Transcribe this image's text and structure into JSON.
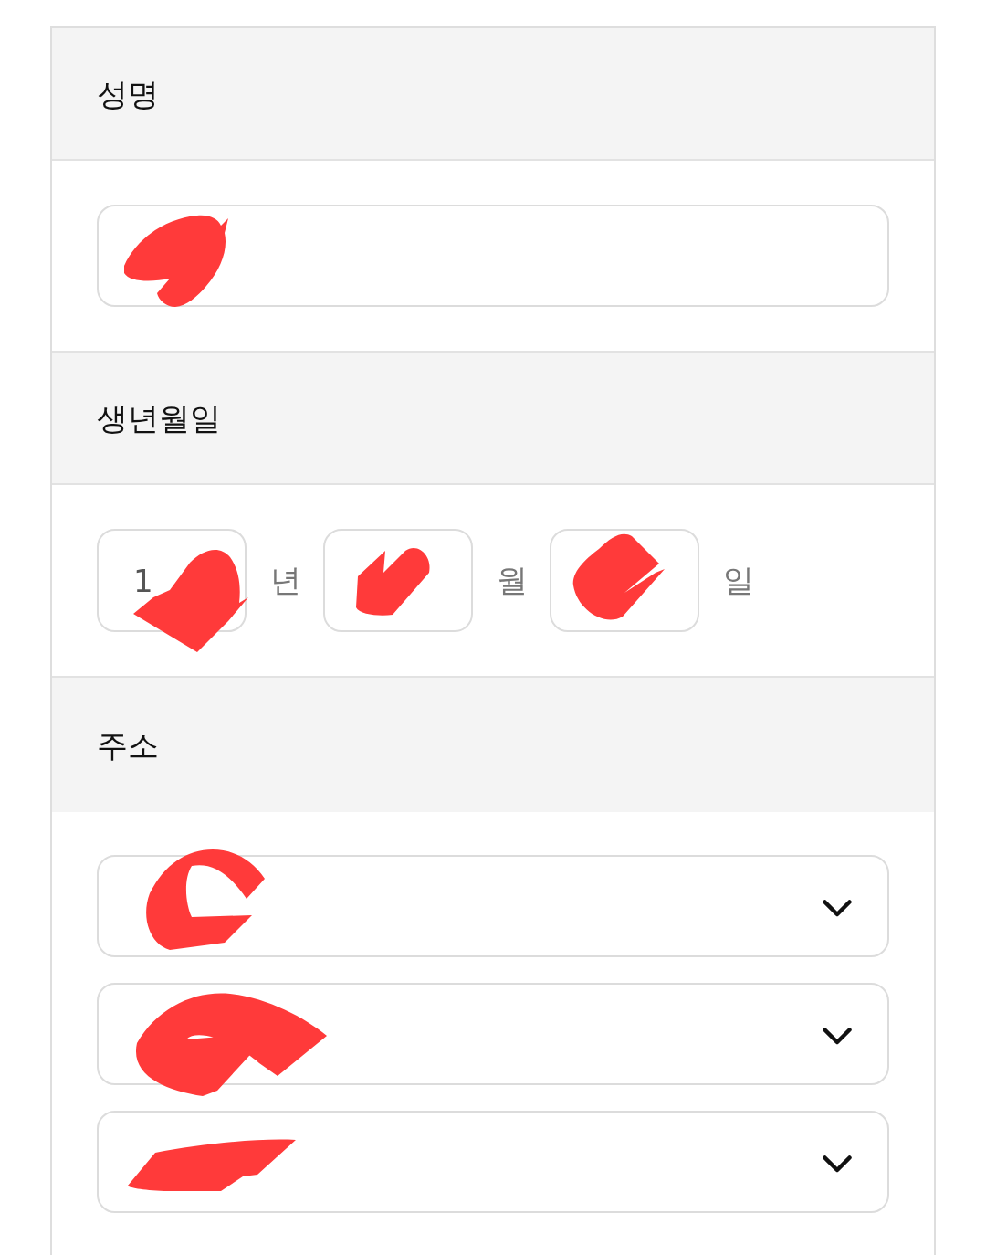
{
  "sections": [
    {
      "kind": "text",
      "title": "성명",
      "fields": [
        {
          "redacted": true
        }
      ]
    },
    {
      "kind": "date",
      "title": "생년월일",
      "fields": [
        {
          "value": "1",
          "unit": "년",
          "redacted": true
        },
        {
          "unit": "월",
          "redacted": true
        },
        {
          "unit": "일",
          "redacted": true
        }
      ]
    },
    {
      "kind": "select",
      "title": "주소",
      "fields": [
        {
          "redacted": true
        },
        {
          "redacted": true
        },
        {
          "redacted": true
        }
      ]
    }
  ]
}
